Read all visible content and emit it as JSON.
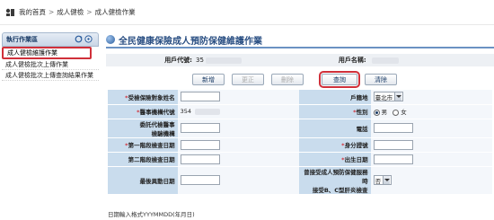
{
  "breadcrumb": {
    "home": "我的首頁",
    "sep": ">",
    "level1": "成人健檢",
    "level2": "成人健檢作業"
  },
  "sidebar": {
    "header": "執行作業區",
    "items": [
      {
        "label": "成人健檢維護作業"
      },
      {
        "label": "成人健檢批次上傳作業"
      },
      {
        "label": "成人健檢批次上傳查詢結果作業"
      }
    ]
  },
  "main": {
    "title": "全民健康保險成人預防保健維護作業",
    "user_code_label": "用戶代號:",
    "user_code_value": "35",
    "user_name_label": "用戶名稱:"
  },
  "buttons": {
    "add": "新增",
    "edit": "更正",
    "delete": "刪除",
    "query": "查詢",
    "clear": "清除"
  },
  "form": {
    "insured_id_label": "受檢保險對象姓名",
    "household_label": "戶籍地",
    "household_value": "臺北市",
    "hosp_code_label": "醫事機構代號",
    "hosp_code_value": "354",
    "gender_label": "性別",
    "gender_male": "男",
    "gender_female": "女",
    "doctor_label": "委託代檢醫事",
    "doctor_label2": "檢驗機構",
    "phone_label": "電話",
    "exam1_label": "第一階段檢查日期",
    "id_label": "身分證號",
    "exam2_label": "第二階段檢查日期",
    "birth_label": "出生日期",
    "last_exam_label": "最後異動日期",
    "hbv_label": "曾接受成人預防保健服務時",
    "hbv_label2": "接受B、C型肝炎檢查",
    "hbv_value": "否"
  },
  "footer": {
    "note": "日期輸入格式YYYMMDD(年月日)"
  }
}
